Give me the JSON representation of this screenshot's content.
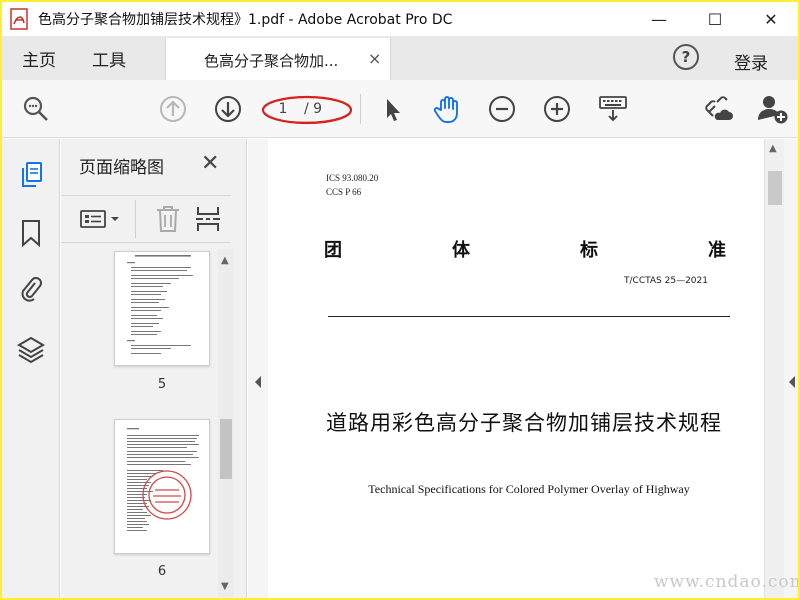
{
  "window": {
    "title": "色高分子聚合物加铺层技术规程》1.pdf - Adobe Acrobat Pro DC",
    "minimize": "—",
    "maximize": "☐",
    "close": "✕"
  },
  "tabbar": {
    "home": "主页",
    "tools": "工具",
    "doc_tab_label": "色高分子聚合物加...",
    "doc_tab_close": "×",
    "help": "?",
    "login": "登录"
  },
  "toolbar": {
    "current_page": "1",
    "page_total": "/ 9",
    "icons": [
      "search-zoom-icon",
      "arrow-up-circle-icon",
      "arrow-down-circle-icon",
      "cursor-arrow-icon",
      "hand-pan-icon",
      "zoom-out-icon",
      "zoom-in-icon",
      "keyboard-scroll-icon",
      "share-link-icon",
      "add-user-icon"
    ],
    "annotation_color": "#d8201c",
    "active_tool_color": "#1473e6"
  },
  "thumbnails_panel": {
    "title": "页面缩略图",
    "close": "✕",
    "pages": [
      {
        "number": "5"
      },
      {
        "number": "6"
      }
    ]
  },
  "document": {
    "ics": "ICS  93.080.20",
    "ccs": "CCS  P 66",
    "standard_chars": [
      "团",
      "体",
      "标",
      "准"
    ],
    "code": "T/CCTAS 25—2021",
    "title_cn": "道路用彩色高分子聚合物加铺层技术规程",
    "title_en": "Technical Specifications for Colored Polymer Overlay of Highway"
  },
  "watermark": "www.cndao.com"
}
